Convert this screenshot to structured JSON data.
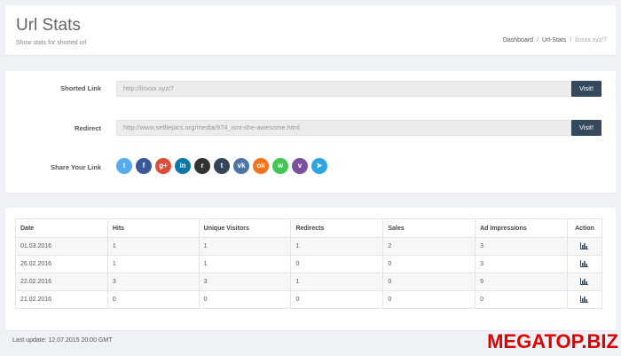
{
  "header": {
    "title": "Url Stats",
    "subtitle": "Show stats for shorted url",
    "breadcrumb": [
      "Dashboard",
      "Url-Stats",
      "linxxx.xyz/7"
    ]
  },
  "form": {
    "shorted_label": "Shorted Link",
    "shorted_value": "http://linxxx.xyz/7",
    "redirect_label": "Redirect",
    "redirect_value": "http://www.selfiepics.org/media/974_isnt-she-awesome.html",
    "visit_label": "Visit!",
    "share_label": "Share Your Link",
    "share_icons": [
      {
        "name": "twitter-icon",
        "glyph": "t",
        "color": "#55acee"
      },
      {
        "name": "facebook-icon",
        "glyph": "f",
        "color": "#3b5998"
      },
      {
        "name": "google-plus-icon",
        "glyph": "g+",
        "color": "#dd4b39"
      },
      {
        "name": "linkedin-icon",
        "glyph": "in",
        "color": "#0e76a8"
      },
      {
        "name": "reddit-icon",
        "glyph": "r",
        "color": "#333333"
      },
      {
        "name": "tumblr-icon",
        "glyph": "t",
        "color": "#35465c"
      },
      {
        "name": "vk-icon",
        "glyph": "vk",
        "color": "#4c75a3"
      },
      {
        "name": "odnoklassniki-icon",
        "glyph": "ok",
        "color": "#f4731c"
      },
      {
        "name": "whatsapp-icon",
        "glyph": "w",
        "color": "#43c553"
      },
      {
        "name": "viber-icon",
        "glyph": "v",
        "color": "#7b519d"
      },
      {
        "name": "telegram-icon",
        "glyph": "➤",
        "color": "#2ca5e0"
      }
    ]
  },
  "table": {
    "headers": [
      "Date",
      "Hits",
      "Unique Visitors",
      "Redirects",
      "Sales",
      "Ad Impressions",
      "Action"
    ],
    "rows": [
      [
        "01.03.2016",
        "1",
        "1",
        "1",
        "2",
        "3"
      ],
      [
        "26.02.2016",
        "1",
        "1",
        "0",
        "0",
        "3"
      ],
      [
        "22.02.2016",
        "3",
        "3",
        "1",
        "0",
        "9"
      ],
      [
        "21.02.2016",
        "0",
        "0",
        "0",
        "0",
        "0"
      ]
    ],
    "action_icon": "bar-chart-icon"
  },
  "footer": {
    "last_update": "Last update: 12.07.2015 20:00 GMT"
  },
  "watermark": "MEGATOP.BIZ",
  "colors": {
    "visit_button": "#34495e",
    "watermark": "#e00000",
    "action_icon": "#34495e"
  }
}
